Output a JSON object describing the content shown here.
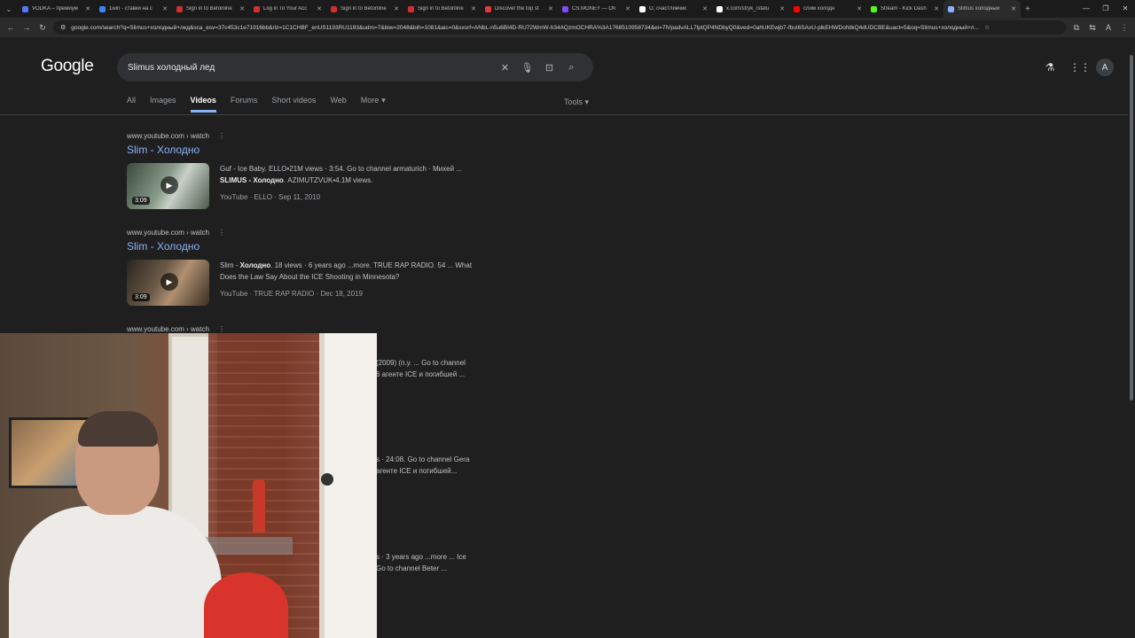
{
  "browser": {
    "tabs": [
      {
        "label": "VODKA – премиум",
        "color": "#4f7cff"
      },
      {
        "label": "1win - ставки на с",
        "color": "#3b82f6"
      },
      {
        "label": "Sign in to Betonline",
        "color": "#d32f2f"
      },
      {
        "label": "Log in To Your Acc",
        "color": "#d32f2f"
      },
      {
        "label": "Sign in to Betonline",
        "color": "#d32f2f"
      },
      {
        "label": "Sign in to Betonline",
        "color": "#d32f2f"
      },
      {
        "label": "Discover the top st",
        "color": "#e53935"
      },
      {
        "label": "CS.MONEY — Ofi",
        "color": "#7c4dff"
      },
      {
        "label": "O, счастливчик",
        "color": "#ffffff"
      },
      {
        "label": "x.com/stryk_/statu",
        "color": "#ffffff"
      },
      {
        "label": "слим холодн",
        "color": "#ff0000"
      },
      {
        "label": "Stream - Kick Dash",
        "color": "#53fc18"
      },
      {
        "label": "Slimus холодный",
        "color": "#8ab4f8",
        "active": true
      }
    ],
    "url": "google.com/search?q=Slimus+холодный+лед&sca_esv=37c453c1e71916bb&rlz=1C1CHBF_enUS1193RU1193&udm=7&biw=2048&bih=1081&aic=0&sxsrf=ANbL-n5u6BI4D-RU72WmW-h34AQzmOCHRA%3A1768510958734&ei=7lVpadvALL7lptQP4NDbyQ0&ved=0ahUKEwjb7-fbuI6SAxU-plkEHWDoNtkQ4dUDCBE&uact=5&oq=Slimus+холодный+л..."
  },
  "google": {
    "logo": "Google",
    "query": "Slimus холодный лед",
    "tabs": [
      "All",
      "Images",
      "Videos",
      "Forums",
      "Short videos",
      "Web",
      "More"
    ],
    "active_tab": "Videos",
    "tools": "Tools"
  },
  "results": [
    {
      "source": "www.youtube.com › watch",
      "title": "Slim - Холодно",
      "desc_line1": "Guf - Ice Baby. ELLO•21M views · 3:54. Go to channel armaturich · Михей ...",
      "desc_bold": "SLIMUS - Холодно",
      "desc_line2_rest": ". AZIMUTZVUK•4.1M views.",
      "meta": "YouTube · ELLO · Sep 11, 2010",
      "duration": "3:09"
    },
    {
      "source": "www.youtube.com › watch",
      "title": "Slim - Холодно",
      "desc_prefix": "Slim - ",
      "desc_bold": "Холодно",
      "desc_line1_rest": ". 18 views · 6 years ago ...more. TRUE RAP RADIO. 54 ... What",
      "desc_line2": "Does the Law Say About the ICE Shooting in Minnesota?",
      "meta": "YouTube · TRUE RAP RADIO · Dec 18, 2019",
      "duration": "3:09"
    },
    {
      "source": "www.youtube.com › watch"
    }
  ],
  "partials": [
    {
      "l1": "(2009) (п.у. ... Go to channel",
      "l2": "6 агенте ICE и погибшей ..."
    },
    {
      "l1": "s · 24:08. Go to channel Gera",
      "l2": "агенте ICE и погибшей..."
    },
    {
      "l1": "s · 3 years ago ...more ... Ice",
      "l2": "Go to channel Beter ..."
    }
  ]
}
